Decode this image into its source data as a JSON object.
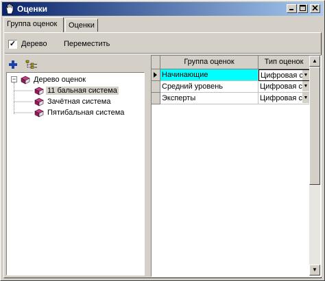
{
  "window": {
    "title": "Оценки",
    "icon": "hand-icon"
  },
  "tabs": [
    {
      "label": "Группа оценок",
      "active": true
    },
    {
      "label": "Оценки",
      "active": false
    }
  ],
  "toolbar": {
    "tree_checkbox_label": "Дерево",
    "tree_checked": true,
    "move_label": "Переместить"
  },
  "tree": {
    "root": "Дерево оценок",
    "children": [
      "11 бальная система",
      "Зачётная система",
      "Пятибальная система"
    ],
    "selected_index": 0
  },
  "grid": {
    "columns": [
      "Группа оценок",
      "Тип оценок"
    ],
    "rows": [
      {
        "group": "Начинающие",
        "type": "Цифровая с"
      },
      {
        "group": "Средний уровень",
        "type": "Цифровая с"
      },
      {
        "group": "Эксперты",
        "type": "Цифровая с"
      }
    ],
    "current_row_index": 0
  },
  "colors": {
    "title_start": "#0a246a",
    "title_end": "#a6caf0",
    "selected_cell": "#00ffff",
    "face": "#d4d0c8"
  }
}
